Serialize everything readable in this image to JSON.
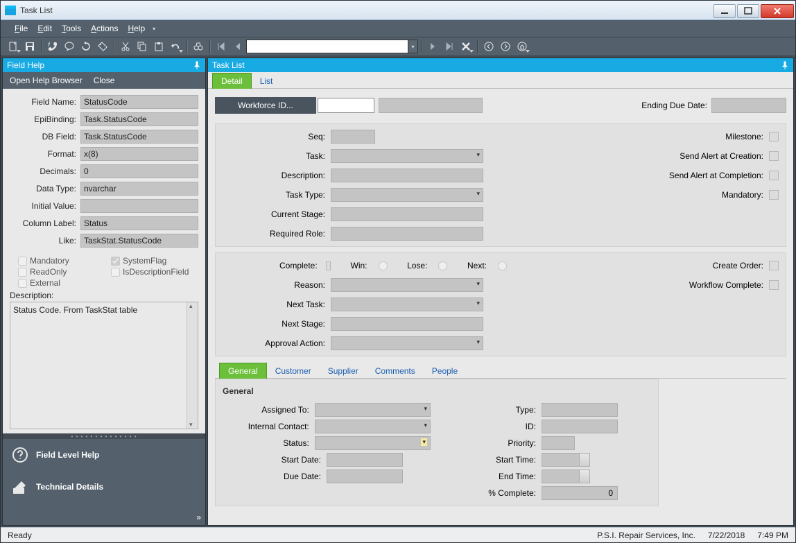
{
  "window": {
    "title": "Task List"
  },
  "menus": {
    "file": "File",
    "edit": "Edit",
    "tools": "Tools",
    "actions": "Actions",
    "help": "Help"
  },
  "leftPanel": {
    "header": "Field Help",
    "openHelp": "Open Help Browser",
    "close": "Close",
    "fields": {
      "fieldName_lbl": "Field Name:",
      "fieldName": "StatusCode",
      "epiBinding_lbl": "EpiBinding:",
      "epiBinding": "Task.StatusCode",
      "dbField_lbl": "DB Field:",
      "dbField": "Task.StatusCode",
      "format_lbl": "Format:",
      "format": "x(8)",
      "decimals_lbl": "Decimals:",
      "decimals": "0",
      "dataType_lbl": "Data Type:",
      "dataType": "nvarchar",
      "initialValue_lbl": "Initial Value:",
      "initialValue": "",
      "columnLabel_lbl": "Column Label:",
      "columnLabel": "Status",
      "like_lbl": "Like:",
      "like": "TaskStat.StatusCode"
    },
    "checks": {
      "mandatory": "Mandatory",
      "systemFlag": "SystemFlag",
      "readOnly": "ReadOnly",
      "isDescField": "IsDescriptionField",
      "external": "External",
      "systemFlag_checked": true
    },
    "desc_lbl": "Description:",
    "desc": "Status Code. From TaskStat table",
    "bottom": {
      "fieldLevelHelp": "Field Level Help",
      "technicalDetails": "Technical Details"
    }
  },
  "rightPanel": {
    "header": "Task List",
    "tabs": {
      "detail": "Detail",
      "list": "List"
    },
    "top": {
      "workforceBtn": "Workforce ID...",
      "endingDueDate_lbl": "Ending Due Date:"
    },
    "sec1": {
      "seq": "Seq:",
      "task": "Task:",
      "description": "Description:",
      "taskType": "Task Type:",
      "currentStage": "Current Stage:",
      "requiredRole": "Required Role:",
      "milestone": "Milestone:",
      "sendAlertCreation": "Send Alert at Creation:",
      "sendAlertCompletion": "Send Alert at Completion:",
      "mandatory": "Mandatory:"
    },
    "sec2": {
      "complete": "Complete:",
      "win": "Win:",
      "lose": "Lose:",
      "next": "Next:",
      "reason": "Reason:",
      "nextTask": "Next Task:",
      "nextStage": "Next Stage:",
      "approvalAction": "Approval Action:",
      "createOrder": "Create Order:",
      "workflowComplete": "Workflow Complete:"
    },
    "subtabs": {
      "general": "General",
      "customer": "Customer",
      "supplier": "Supplier",
      "comments": "Comments",
      "people": "People"
    },
    "general": {
      "header": "General",
      "assignedTo": "Assigned To:",
      "internalContact": "Internal Contact:",
      "status": "Status:",
      "startDate": "Start Date:",
      "dueDate": "Due Date:",
      "type": "Type:",
      "id": "ID:",
      "priority": "Priority:",
      "startTime": "Start Time:",
      "endTime": "End Time:",
      "pctComplete": "% Complete:",
      "pctValue": "0"
    }
  },
  "status": {
    "ready": "Ready",
    "company": "P.S.I. Repair Services, Inc.",
    "date": "7/22/2018",
    "time": "7:49 PM"
  }
}
